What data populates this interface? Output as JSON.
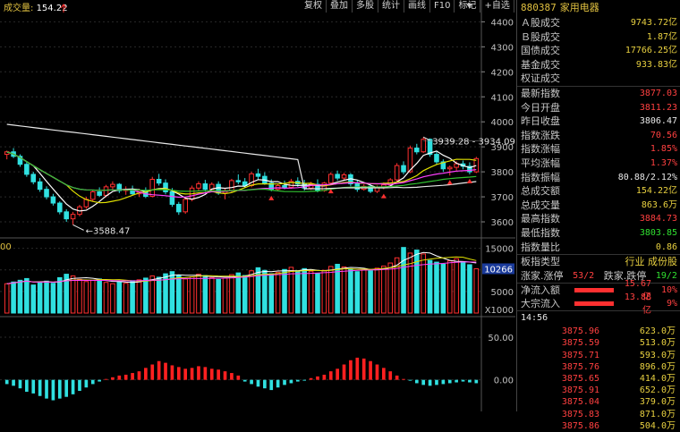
{
  "toolbar": [
    {
      "label": "复权",
      "name": "toolbar-fuquan-button"
    },
    {
      "label": "叠加",
      "name": "toolbar-overlay-button"
    },
    {
      "label": "多股",
      "name": "toolbar-multistock-button"
    },
    {
      "label": "统计",
      "name": "toolbar-stats-button"
    },
    {
      "label": "画线",
      "name": "toolbar-draw-button"
    },
    {
      "label": "F10",
      "name": "toolbar-f10-button"
    },
    {
      "label": "标记",
      "name": "toolbar-mark-button"
    },
    {
      "label": "+自选",
      "name": "toolbar-add-watchlist-button"
    }
  ],
  "chart": {
    "volume_label": "成交量: ",
    "volume_value": "154.22",
    "price_ticks": [
      "4400",
      "4300",
      "4200",
      "4100",
      "4000",
      "3900",
      "3800",
      "3700",
      "3600"
    ],
    "price_range": [
      3550,
      4430
    ],
    "high_annotation": "3939.28 - 3934.09",
    "low_annotation": "3588.47",
    "vol_ticks": [
      "15000",
      "10000",
      "5000"
    ],
    "vol_current": "10266",
    "vol_unit": "X1000",
    "vol_left_label": "00",
    "macd_ticks": [
      "50.00",
      "0.00"
    ],
    "colors": {
      "up": "#ff3030",
      "down": "#30e0e0",
      "ma5": "#ffffff",
      "ma10": "#e0e000",
      "ma20": "#ff40ff",
      "ma60": "#30c030",
      "macd_up": "#ff2020",
      "macd_down": "#30e0e0"
    }
  },
  "chart_data": {
    "type": "candlestick",
    "candles": [
      [
        3870,
        3885,
        3850,
        3880
      ],
      [
        3880,
        3895,
        3855,
        3862
      ],
      [
        3862,
        3870,
        3820,
        3830
      ],
      [
        3830,
        3838,
        3780,
        3790
      ],
      [
        3790,
        3800,
        3750,
        3760
      ],
      [
        3760,
        3775,
        3720,
        3730
      ],
      [
        3730,
        3742,
        3690,
        3700
      ],
      [
        3700,
        3712,
        3665,
        3675
      ],
      [
        3675,
        3682,
        3630,
        3640
      ],
      [
        3640,
        3650,
        3600,
        3612
      ],
      [
        3612,
        3640,
        3588,
        3630
      ],
      [
        3630,
        3668,
        3622,
        3660
      ],
      [
        3660,
        3700,
        3652,
        3690
      ],
      [
        3690,
        3728,
        3682,
        3720
      ],
      [
        3720,
        3738,
        3700,
        3706
      ],
      [
        3706,
        3748,
        3698,
        3740
      ],
      [
        3740,
        3762,
        3728,
        3750
      ],
      [
        3750,
        3755,
        3715,
        3725
      ],
      [
        3725,
        3742,
        3708,
        3730
      ],
      [
        3730,
        3745,
        3705,
        3712
      ],
      [
        3712,
        3732,
        3700,
        3725
      ],
      [
        3725,
        3738,
        3695,
        3702
      ],
      [
        3702,
        3780,
        3698,
        3770
      ],
      [
        3770,
        3792,
        3745,
        3755
      ],
      [
        3755,
        3770,
        3710,
        3720
      ],
      [
        3720,
        3735,
        3660,
        3670
      ],
      [
        3670,
        3680,
        3628,
        3640
      ],
      [
        3640,
        3700,
        3632,
        3690
      ],
      [
        3690,
        3745,
        3682,
        3735
      ],
      [
        3735,
        3762,
        3725,
        3752
      ],
      [
        3752,
        3768,
        3720,
        3730
      ],
      [
        3730,
        3758,
        3722,
        3750
      ],
      [
        3750,
        3762,
        3708,
        3715
      ],
      [
        3715,
        3735,
        3690,
        3725
      ],
      [
        3725,
        3772,
        3718,
        3765
      ],
      [
        3765,
        3790,
        3750,
        3760
      ],
      [
        3760,
        3775,
        3735,
        3745
      ],
      [
        3745,
        3800,
        3738,
        3792
      ],
      [
        3792,
        3812,
        3770,
        3782
      ],
      [
        3782,
        3798,
        3748,
        3755
      ],
      [
        3755,
        3770,
        3722,
        3730
      ],
      [
        3730,
        3752,
        3722,
        3745
      ],
      [
        3745,
        3765,
        3730,
        3738
      ],
      [
        3738,
        3772,
        3732,
        3762
      ],
      [
        3762,
        3778,
        3740,
        3752
      ],
      [
        3752,
        3768,
        3725,
        3735
      ],
      [
        3735,
        3760,
        3728,
        3750
      ],
      [
        3750,
        3770,
        3718,
        3725
      ],
      [
        3725,
        3760,
        3720,
        3755
      ],
      [
        3755,
        3798,
        3750,
        3790
      ],
      [
        3790,
        3805,
        3765,
        3775
      ],
      [
        3775,
        3796,
        3768,
        3788
      ],
      [
        3788,
        3795,
        3742,
        3752
      ],
      [
        3752,
        3765,
        3720,
        3730
      ],
      [
        3730,
        3750,
        3725,
        3742
      ],
      [
        3742,
        3752,
        3715,
        3722
      ],
      [
        3722,
        3745,
        3715,
        3738
      ],
      [
        3738,
        3758,
        3730,
        3748
      ],
      [
        3748,
        3775,
        3740,
        3768
      ],
      [
        3768,
        3835,
        3762,
        3825
      ],
      [
        3825,
        3842,
        3790,
        3800
      ],
      [
        3800,
        3905,
        3795,
        3895
      ],
      [
        3895,
        3912,
        3870,
        3880
      ],
      [
        3880,
        3939,
        3875,
        3930
      ],
      [
        3930,
        3934,
        3860,
        3870
      ],
      [
        3870,
        3880,
        3830,
        3840
      ],
      [
        3840,
        3850,
        3800,
        3812
      ],
      [
        3812,
        3825,
        3785,
        3818
      ],
      [
        3818,
        3842,
        3805,
        3832
      ],
      [
        3832,
        3845,
        3810,
        3822
      ],
      [
        3822,
        3838,
        3790,
        3800
      ],
      [
        3800,
        3860,
        3795,
        3853
      ]
    ],
    "ma_series": [
      "ma5",
      "ma10",
      "ma20",
      "ma60"
    ],
    "volumes": [
      6800,
      7200,
      7600,
      8000,
      6500,
      7000,
      7400,
      6900,
      8200,
      9000,
      8600,
      7800,
      7300,
      7600,
      7900,
      7100,
      6800,
      7200,
      6900,
      7500,
      7700,
      8100,
      8600,
      8300,
      9100,
      9600,
      8800,
      7900,
      8400,
      9000,
      8700,
      8200,
      7800,
      8100,
      8900,
      9300,
      8700,
      9800,
      10500,
      9900,
      9100,
      9400,
      10100,
      10600,
      9800,
      10300,
      9700,
      9200,
      9900,
      10800,
      11300,
      10700,
      10200,
      9600,
      10100,
      9800,
      10400,
      10900,
      11600,
      12800,
      15200,
      13900,
      14600,
      13700,
      12200,
      11800,
      11300,
      12100,
      12600,
      11900,
      11200,
      10266
    ],
    "macd": [
      -5,
      -7,
      -10,
      -14,
      -16,
      -19,
      -22,
      -24,
      -22,
      -20,
      -17,
      -13,
      -9,
      -5,
      -2,
      1,
      3,
      5,
      6,
      8,
      10,
      14,
      18,
      22,
      20,
      17,
      15,
      13,
      14,
      16,
      15,
      13,
      12,
      10,
      8,
      5,
      -2,
      -5,
      -8,
      -10,
      -12,
      -9,
      -6,
      -4,
      -2,
      -1,
      2,
      4,
      6,
      10,
      13,
      18,
      23,
      26,
      25,
      22,
      18,
      14,
      10,
      5,
      1,
      -1,
      -4,
      -6,
      -7,
      -6,
      -5,
      -4,
      -3,
      -2,
      -3,
      -4
    ],
    "macd_range": [
      -35,
      70
    ]
  },
  "sidebar": {
    "code": "880387",
    "name": "家用电器",
    "groups": [
      {
        "rows": [
          {
            "label": "Ａ股成交",
            "value": "9743.72亿",
            "color": "yel"
          },
          {
            "label": "Ｂ股成交",
            "value": "1.87亿",
            "color": "yel"
          },
          {
            "label": "国债成交",
            "value": "17766.25亿",
            "color": "yel"
          },
          {
            "label": "基金成交",
            "value": "933.83亿",
            "color": "yel"
          },
          {
            "label": "权证成交",
            "value": "",
            "color": "yel"
          }
        ]
      },
      {
        "rows": [
          {
            "label": "最新指数",
            "value": "3877.03",
            "color": "red"
          },
          {
            "label": "今日开盘",
            "value": "3811.23",
            "color": "red"
          },
          {
            "label": "昨日收盘",
            "value": "3806.47",
            "color": "wht"
          },
          {
            "label": "指数涨跌",
            "value": "70.56",
            "color": "red"
          },
          {
            "label": "指数涨幅",
            "value": "1.85%",
            "color": "red"
          },
          {
            "label": "平均涨幅",
            "value": "1.37%",
            "color": "red"
          },
          {
            "label": "指数振幅",
            "value": "80.88/2.12%",
            "color": "wht"
          },
          {
            "label": "总成交额",
            "value": "154.22亿",
            "color": "yel"
          },
          {
            "label": "总成交量",
            "value": "863.6万",
            "color": "yel"
          },
          {
            "label": "最高指数",
            "value": "3884.73",
            "color": "red"
          },
          {
            "label": "最低指数",
            "value": "3803.85",
            "color": "grn"
          },
          {
            "label": "指数量比",
            "value": "0.86",
            "color": "yel"
          }
        ]
      }
    ],
    "board_type_label": "板指类型",
    "board_type_value": "行业 成份股",
    "updown_label": "涨家.涨停",
    "updown_value": "53/2",
    "downdown_label": "跌家.跌停",
    "downdown_value": "19/2",
    "flows": [
      {
        "label": "净流入额",
        "amount": "15.67亿",
        "pct": "10%"
      },
      {
        "label": "大宗流入",
        "amount": "13.88亿",
        "pct": "9%"
      }
    ],
    "tick_time": "14:56",
    "ticks": [
      {
        "price": "3875.96",
        "vol": "623.0万"
      },
      {
        "price": "3875.59",
        "vol": "513.0万"
      },
      {
        "price": "3875.71",
        "vol": "593.0万"
      },
      {
        "price": "3875.76",
        "vol": "896.0万"
      },
      {
        "price": "3875.65",
        "vol": "414.0万"
      },
      {
        "price": "3875.91",
        "vol": "652.0万"
      },
      {
        "price": "3875.04",
        "vol": "379.0万"
      },
      {
        "price": "3875.83",
        "vol": "871.0万"
      },
      {
        "price": "3875.86",
        "vol": "504.0万"
      }
    ]
  }
}
